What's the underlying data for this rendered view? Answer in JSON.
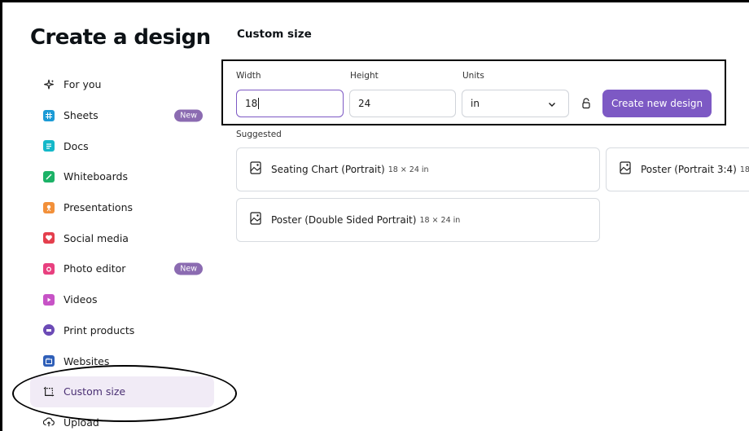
{
  "sidebar": {
    "title": "Create a design",
    "items": [
      {
        "label": "For you",
        "badge": "",
        "icon": "sparkle-icon",
        "color": "#1a1a1a"
      },
      {
        "label": "Sheets",
        "badge": "New",
        "icon": "sheets-icon",
        "color": "#1c9bd6"
      },
      {
        "label": "Docs",
        "badge": "",
        "icon": "docs-icon",
        "color": "#14b8c9"
      },
      {
        "label": "Whiteboards",
        "badge": "",
        "icon": "whiteboard-icon",
        "color": "#1cb267"
      },
      {
        "label": "Presentations",
        "badge": "",
        "icon": "presentation-icon",
        "color": "#f2903a"
      },
      {
        "label": "Social media",
        "badge": "",
        "icon": "heart-icon",
        "color": "#e43f4d"
      },
      {
        "label": "Photo editor",
        "badge": "New",
        "icon": "camera-icon",
        "color": "#e8407f"
      },
      {
        "label": "Videos",
        "badge": "",
        "icon": "video-icon",
        "color": "#c753c6"
      },
      {
        "label": "Print products",
        "badge": "",
        "icon": "print-icon",
        "color": "#6c4bb6"
      },
      {
        "label": "Websites",
        "badge": "",
        "icon": "website-icon",
        "color": "#2f5fb8"
      },
      {
        "label": "Custom size",
        "badge": "",
        "icon": "custom-size-icon",
        "color": "#1a1a1a",
        "active": true
      },
      {
        "label": "Upload",
        "badge": "",
        "icon": "upload-icon",
        "color": "#1a1a1a"
      }
    ]
  },
  "main": {
    "title": "Custom size",
    "width": {
      "label": "Width",
      "value": "18"
    },
    "height": {
      "label": "Height",
      "value": "24"
    },
    "units": {
      "label": "Units",
      "value": "in"
    },
    "create_button": "Create new design",
    "suggested_label": "Suggested",
    "suggestions": [
      {
        "name": "Seating Chart (Portrait)",
        "size": "18 × 24 in"
      },
      {
        "name": "Poster (Portrait 3:4)",
        "size": "18"
      },
      {
        "name": "Poster (Double Sided Portrait)",
        "size": "18 × 24 in"
      }
    ]
  },
  "colors": {
    "accent": "#7d59c4",
    "active_bg": "#f1ebf6",
    "badge": "#8b6bb1"
  }
}
